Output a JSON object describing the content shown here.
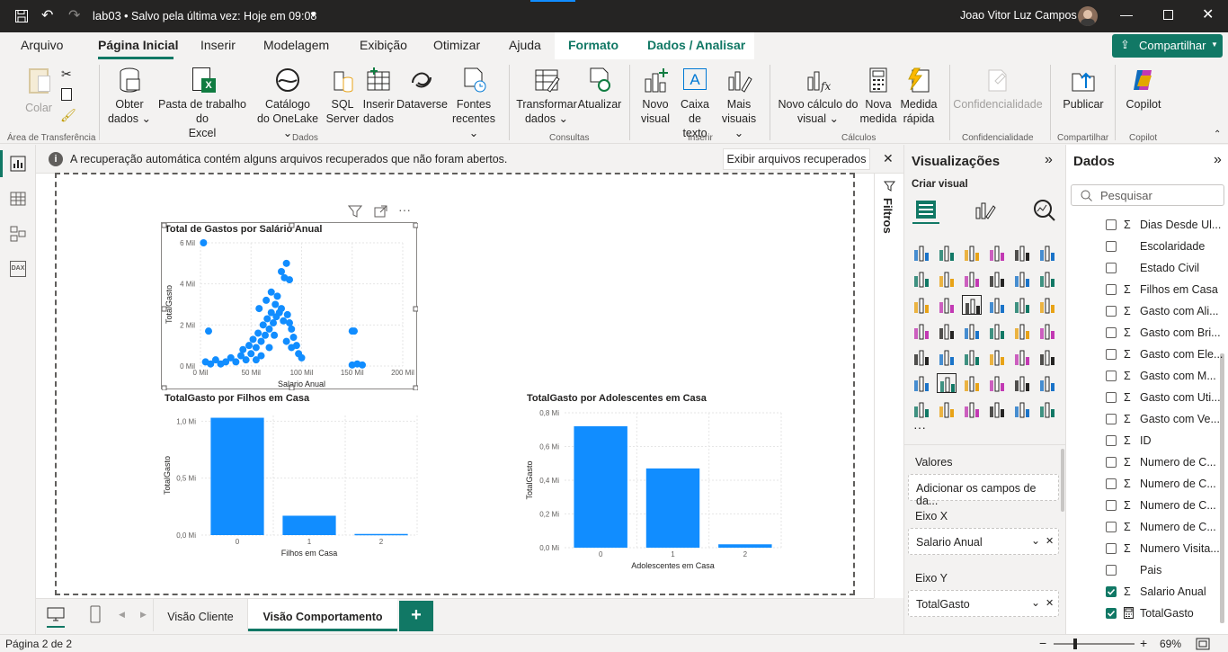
{
  "titlebar": {
    "file": "lab03",
    "status": "Salvo pela última vez: Hoje em 09:08",
    "user": "Joao Vitor Luz Campos"
  },
  "menu": {
    "tabs": [
      "Arquivo",
      "Página Inicial",
      "Inserir",
      "Modelagem",
      "Exibição",
      "Otimizar",
      "Ajuda",
      "Formato",
      "Dados / Analisar"
    ],
    "share": "Compartilhar"
  },
  "ribbon": {
    "colar": "Colar",
    "obter": "Obter",
    "obter2": "dados",
    "pasta": "Pasta de trabalho do",
    "pasta2": "Excel",
    "catalogo": "Catálogo",
    "catalogo2": "do OneLake",
    "sql": "SQL",
    "sql2": "Server",
    "inserir": "Inserir",
    "inserir2": "dados",
    "dataverse": "Dataverse",
    "fontes": "Fontes",
    "fontes2": "recentes",
    "transformar": "Transformar",
    "transformar2": "dados",
    "atualizar": "Atualizar",
    "novo_visual": "Novo",
    "novo_visual2": "visual",
    "caixa": "Caixa de",
    "caixa2": "texto",
    "mais": "Mais",
    "mais2": "visuais",
    "novo_calc": "Novo cálculo do",
    "novo_calc2": "visual",
    "nova_medida": "Nova",
    "nova_medida2": "medida",
    "medida_rapida": "Medida",
    "medida_rapida2": "rápida",
    "confidencialidade": "Confidencialidade",
    "publicar": "Publicar",
    "copilot": "Copilot",
    "groups": {
      "area": "Área de Transferência",
      "dados": "Dados",
      "consultas": "Consultas",
      "inserir": "Inserir",
      "calculos": "Cálculos",
      "conf": "Confidencialidade",
      "compartilhar": "Compartilhar",
      "copilot": "Copilot"
    }
  },
  "infobar": {
    "message": "A recuperação automática contém alguns arquivos recuperados que não foram abertos.",
    "button": "Exibir arquivos recuperados"
  },
  "filters": {
    "label": "Filtros"
  },
  "viz": {
    "title": "Visualizações",
    "criar": "Criar visual",
    "valores": "Valores",
    "valores_placeholder": "Adicionar os campos de da...",
    "eixo_x": "Eixo X",
    "eixo_x_field": "Salario Anual",
    "eixo_y": "Eixo Y",
    "eixo_y_field": "TotalGasto",
    "more": "···"
  },
  "data": {
    "title": "Dados",
    "search_placeholder": "Pesquisar",
    "fields": [
      {
        "name": "Dias Desde Ul...",
        "sigma": true,
        "checked": false
      },
      {
        "name": "Escolaridade",
        "sigma": false,
        "checked": false
      },
      {
        "name": "Estado Civil",
        "sigma": false,
        "checked": false
      },
      {
        "name": "Filhos em Casa",
        "sigma": true,
        "checked": false
      },
      {
        "name": "Gasto com Ali...",
        "sigma": true,
        "checked": false
      },
      {
        "name": "Gasto com Bri...",
        "sigma": true,
        "checked": false
      },
      {
        "name": "Gasto com Ele...",
        "sigma": true,
        "checked": false
      },
      {
        "name": "Gasto com M...",
        "sigma": true,
        "checked": false
      },
      {
        "name": "Gasto com Uti...",
        "sigma": true,
        "checked": false
      },
      {
        "name": "Gasto com Ve...",
        "sigma": true,
        "checked": false
      },
      {
        "name": "ID",
        "sigma": true,
        "checked": false
      },
      {
        "name": "Numero de C...",
        "sigma": true,
        "checked": false
      },
      {
        "name": "Numero de C...",
        "sigma": true,
        "checked": false
      },
      {
        "name": "Numero de C...",
        "sigma": true,
        "checked": false
      },
      {
        "name": "Numero de C...",
        "sigma": true,
        "checked": false
      },
      {
        "name": "Numero Visita...",
        "sigma": true,
        "checked": false
      },
      {
        "name": "Pais",
        "sigma": false,
        "checked": false
      },
      {
        "name": "Salario Anual",
        "sigma": true,
        "checked": true
      },
      {
        "name": "TotalGasto",
        "sigma": false,
        "checked": true
      }
    ]
  },
  "pages": {
    "tabs": [
      "Visão Cliente",
      "Visão Comportamento"
    ],
    "active": 1
  },
  "status": {
    "page": "Página 2 de 2",
    "zoom": "69%"
  },
  "chart_data": [
    {
      "type": "scatter",
      "title": "Total de Gastos por Salário Anual",
      "xlabel": "Salario Anual",
      "ylabel": "TotalGasto",
      "xticks": [
        "0 Mil",
        "50 Mil",
        "100 Mil",
        "150 Mil",
        "200 Mil"
      ],
      "yticks": [
        "0 Mil",
        "2 Mil",
        "4 Mil",
        "6 Mil"
      ],
      "xlim": [
        0,
        200
      ],
      "ylim": [
        0,
        6
      ],
      "points": [
        [
          3,
          6
        ],
        [
          5,
          0.2
        ],
        [
          10,
          0.1
        ],
        [
          15,
          0.3
        ],
        [
          20,
          0.1
        ],
        [
          25,
          0.2
        ],
        [
          30,
          0.4
        ],
        [
          35,
          0.2
        ],
        [
          40,
          0.5
        ],
        [
          42,
          0.8
        ],
        [
          45,
          0.3
        ],
        [
          48,
          1
        ],
        [
          50,
          0.6
        ],
        [
          52,
          1.3
        ],
        [
          55,
          0.9
        ],
        [
          57,
          1.6
        ],
        [
          60,
          1.2
        ],
        [
          62,
          2
        ],
        [
          64,
          1.5
        ],
        [
          66,
          2.3
        ],
        [
          68,
          1.8
        ],
        [
          70,
          2.6
        ],
        [
          72,
          2.1
        ],
        [
          74,
          3
        ],
        [
          75,
          2.4
        ],
        [
          76,
          3.4
        ],
        [
          78,
          2.6
        ],
        [
          80,
          2.8
        ],
        [
          82,
          2.2
        ],
        [
          83,
          4.3
        ],
        [
          85,
          5
        ],
        [
          86,
          2.5
        ],
        [
          88,
          2.1
        ],
        [
          90,
          1.8
        ],
        [
          92,
          1.4
        ],
        [
          95,
          1
        ],
        [
          97,
          0.6
        ],
        [
          100,
          0.4
        ],
        [
          8,
          1.7
        ],
        [
          150,
          1.7
        ],
        [
          152,
          1.7
        ],
        [
          150,
          0.05
        ],
        [
          155,
          0.1
        ],
        [
          160,
          0.05
        ],
        [
          58,
          2.8
        ],
        [
          65,
          3.2
        ],
        [
          70,
          3.6
        ],
        [
          80,
          4.6
        ],
        [
          88,
          4.2
        ],
        [
          73,
          1.5
        ],
        [
          68,
          0.9
        ],
        [
          60,
          0.5
        ],
        [
          55,
          0.3
        ],
        [
          85,
          1.2
        ],
        [
          90,
          0.9
        ]
      ]
    },
    {
      "type": "bar",
      "title": "TotalGasto por Filhos em Casa",
      "xlabel": "Filhos em Casa",
      "ylabel": "TotalGasto",
      "categories": [
        "0",
        "1",
        "2"
      ],
      "values": [
        1.03,
        0.17,
        0.01
      ],
      "yticks": [
        "0,0 Mi",
        "0,5 Mi",
        "1,0 Mi"
      ],
      "ylim": [
        0,
        1.05
      ]
    },
    {
      "type": "bar",
      "title": "TotalGasto por Adolescentes em Casa",
      "xlabel": "Adolescentes em Casa",
      "ylabel": "TotalGasto",
      "categories": [
        "0",
        "1",
        "2"
      ],
      "values": [
        0.72,
        0.47,
        0.02
      ],
      "yticks": [
        "0,0 Mi",
        "0,2 Mi",
        "0,4 Mi",
        "0,6 Mi",
        "0,8 Mi"
      ],
      "ylim": [
        0,
        0.8
      ]
    }
  ],
  "colors": {
    "accent": "#117865",
    "series": "#118dff",
    "titlebar": "#252423"
  }
}
